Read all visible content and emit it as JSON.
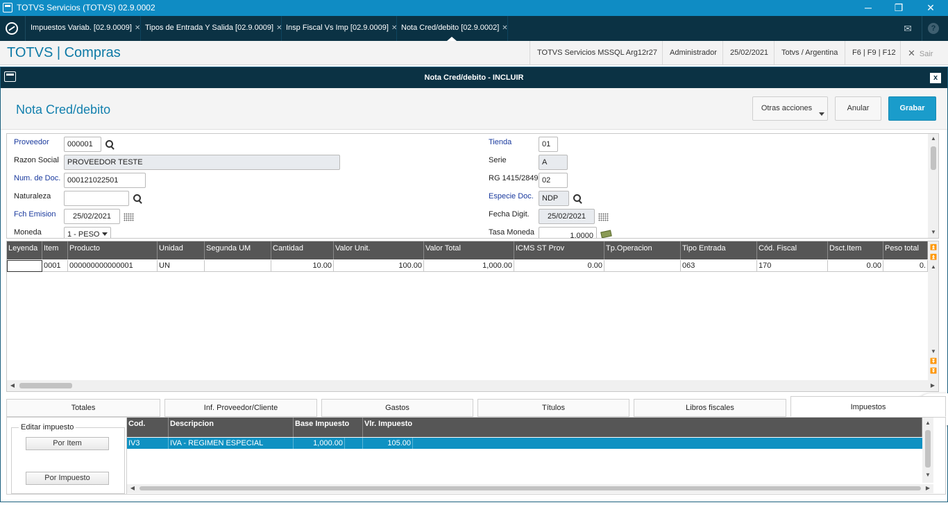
{
  "window": {
    "title": "TOTVS Servicios (TOTVS) 02.9.0002",
    "minimize": "─",
    "restore": "❐",
    "close": "✕"
  },
  "tabs": [
    {
      "label": "Impuestos Variab. [02.9.0009]",
      "close": "✕"
    },
    {
      "label": "Tipos de Entrada Y Salida [02.9.0009]",
      "close": "✕"
    },
    {
      "label": "Insp Fiscal Vs Imp [02.9.0009]",
      "close": "✕"
    },
    {
      "label": "Nota Cred/debito [02.9.0002]",
      "close": "✕"
    }
  ],
  "tabstrip_icons": {
    "mail": "✉",
    "help": "?"
  },
  "header": {
    "brand": "TOTVS | Compras",
    "server": "TOTVS Servicios MSSQL Arg12r27",
    "user": "Administrador",
    "date": "25/02/2021",
    "company": "Totvs / Argentina",
    "shortcuts": "F6 | F9 | F12",
    "exit_icon": "✕",
    "exit_label": "Sair"
  },
  "dialog": {
    "title": "Nota Cred/debito - INCLUIR",
    "close": "x",
    "page_title": "Nota Cred/debito",
    "buttons": {
      "more": "Otras acciones",
      "cancel": "Anular",
      "save": "Grabar"
    }
  },
  "form": {
    "proveedor": {
      "label": "Proveedor",
      "value": "000001"
    },
    "razon": {
      "label": "Razon Social",
      "value": "PROVEEDOR TESTE"
    },
    "numdoc": {
      "label": "Num. de Doc.",
      "value": "000121022501"
    },
    "naturaleza": {
      "label": "Naturaleza",
      "value": ""
    },
    "fchemision": {
      "label": "Fch Emision",
      "value": "25/02/2021"
    },
    "moneda": {
      "label": "Moneda",
      "value": "1 - PESO"
    },
    "tienda": {
      "label": "Tienda",
      "value": "01"
    },
    "serie": {
      "label": "Serie",
      "value": "A"
    },
    "rg": {
      "label": "RG 1415/2849",
      "value": "02"
    },
    "especie": {
      "label": "Especie Doc.",
      "value": "NDP"
    },
    "fechadigit": {
      "label": "Fecha Digit.",
      "value": "25/02/2021"
    },
    "tasa": {
      "label": "Tasa Moneda",
      "value": "1.0000"
    }
  },
  "grid": {
    "headers": [
      "Leyenda",
      "Item",
      "Producto",
      "Unidad",
      "Segunda UM",
      "Cantidad",
      "Valor Unit.",
      "Valor Total",
      "ICMS ST Prov",
      "Tp.Operacion",
      "Tipo Entrada",
      "Cód. Fiscal",
      "Dsct.Item",
      "Peso total"
    ],
    "row": [
      "",
      "0001",
      "000000000000001",
      "UN",
      "",
      "10.00",
      "100.00",
      "1,000.00",
      "0.00",
      "",
      "063",
      "170",
      "0.00",
      "0."
    ]
  },
  "bottom_tabs": [
    "Totales",
    "Inf. Proveedor/Cliente",
    "Gastos",
    "Títulos",
    "Libros fiscales",
    "Impuestos"
  ],
  "impuestos": {
    "group_label": "Editar impuesto",
    "by_item": "Por Item",
    "by_tax": "Por Impuesto",
    "headers": [
      "Cod.",
      "Descripcion",
      "Base Impuesto",
      "Vlr. Impuesto"
    ],
    "row": [
      "IV3",
      "IVA - REGIMEN ESPECIAL",
      "1,000.00",
      "105.00"
    ]
  },
  "colors": {
    "titlebar": "#0f8cc4",
    "dark": "#0b3244",
    "accent": "#1a9ccb",
    "header_grid": "#565656",
    "selected_row": "#0f91c2"
  }
}
